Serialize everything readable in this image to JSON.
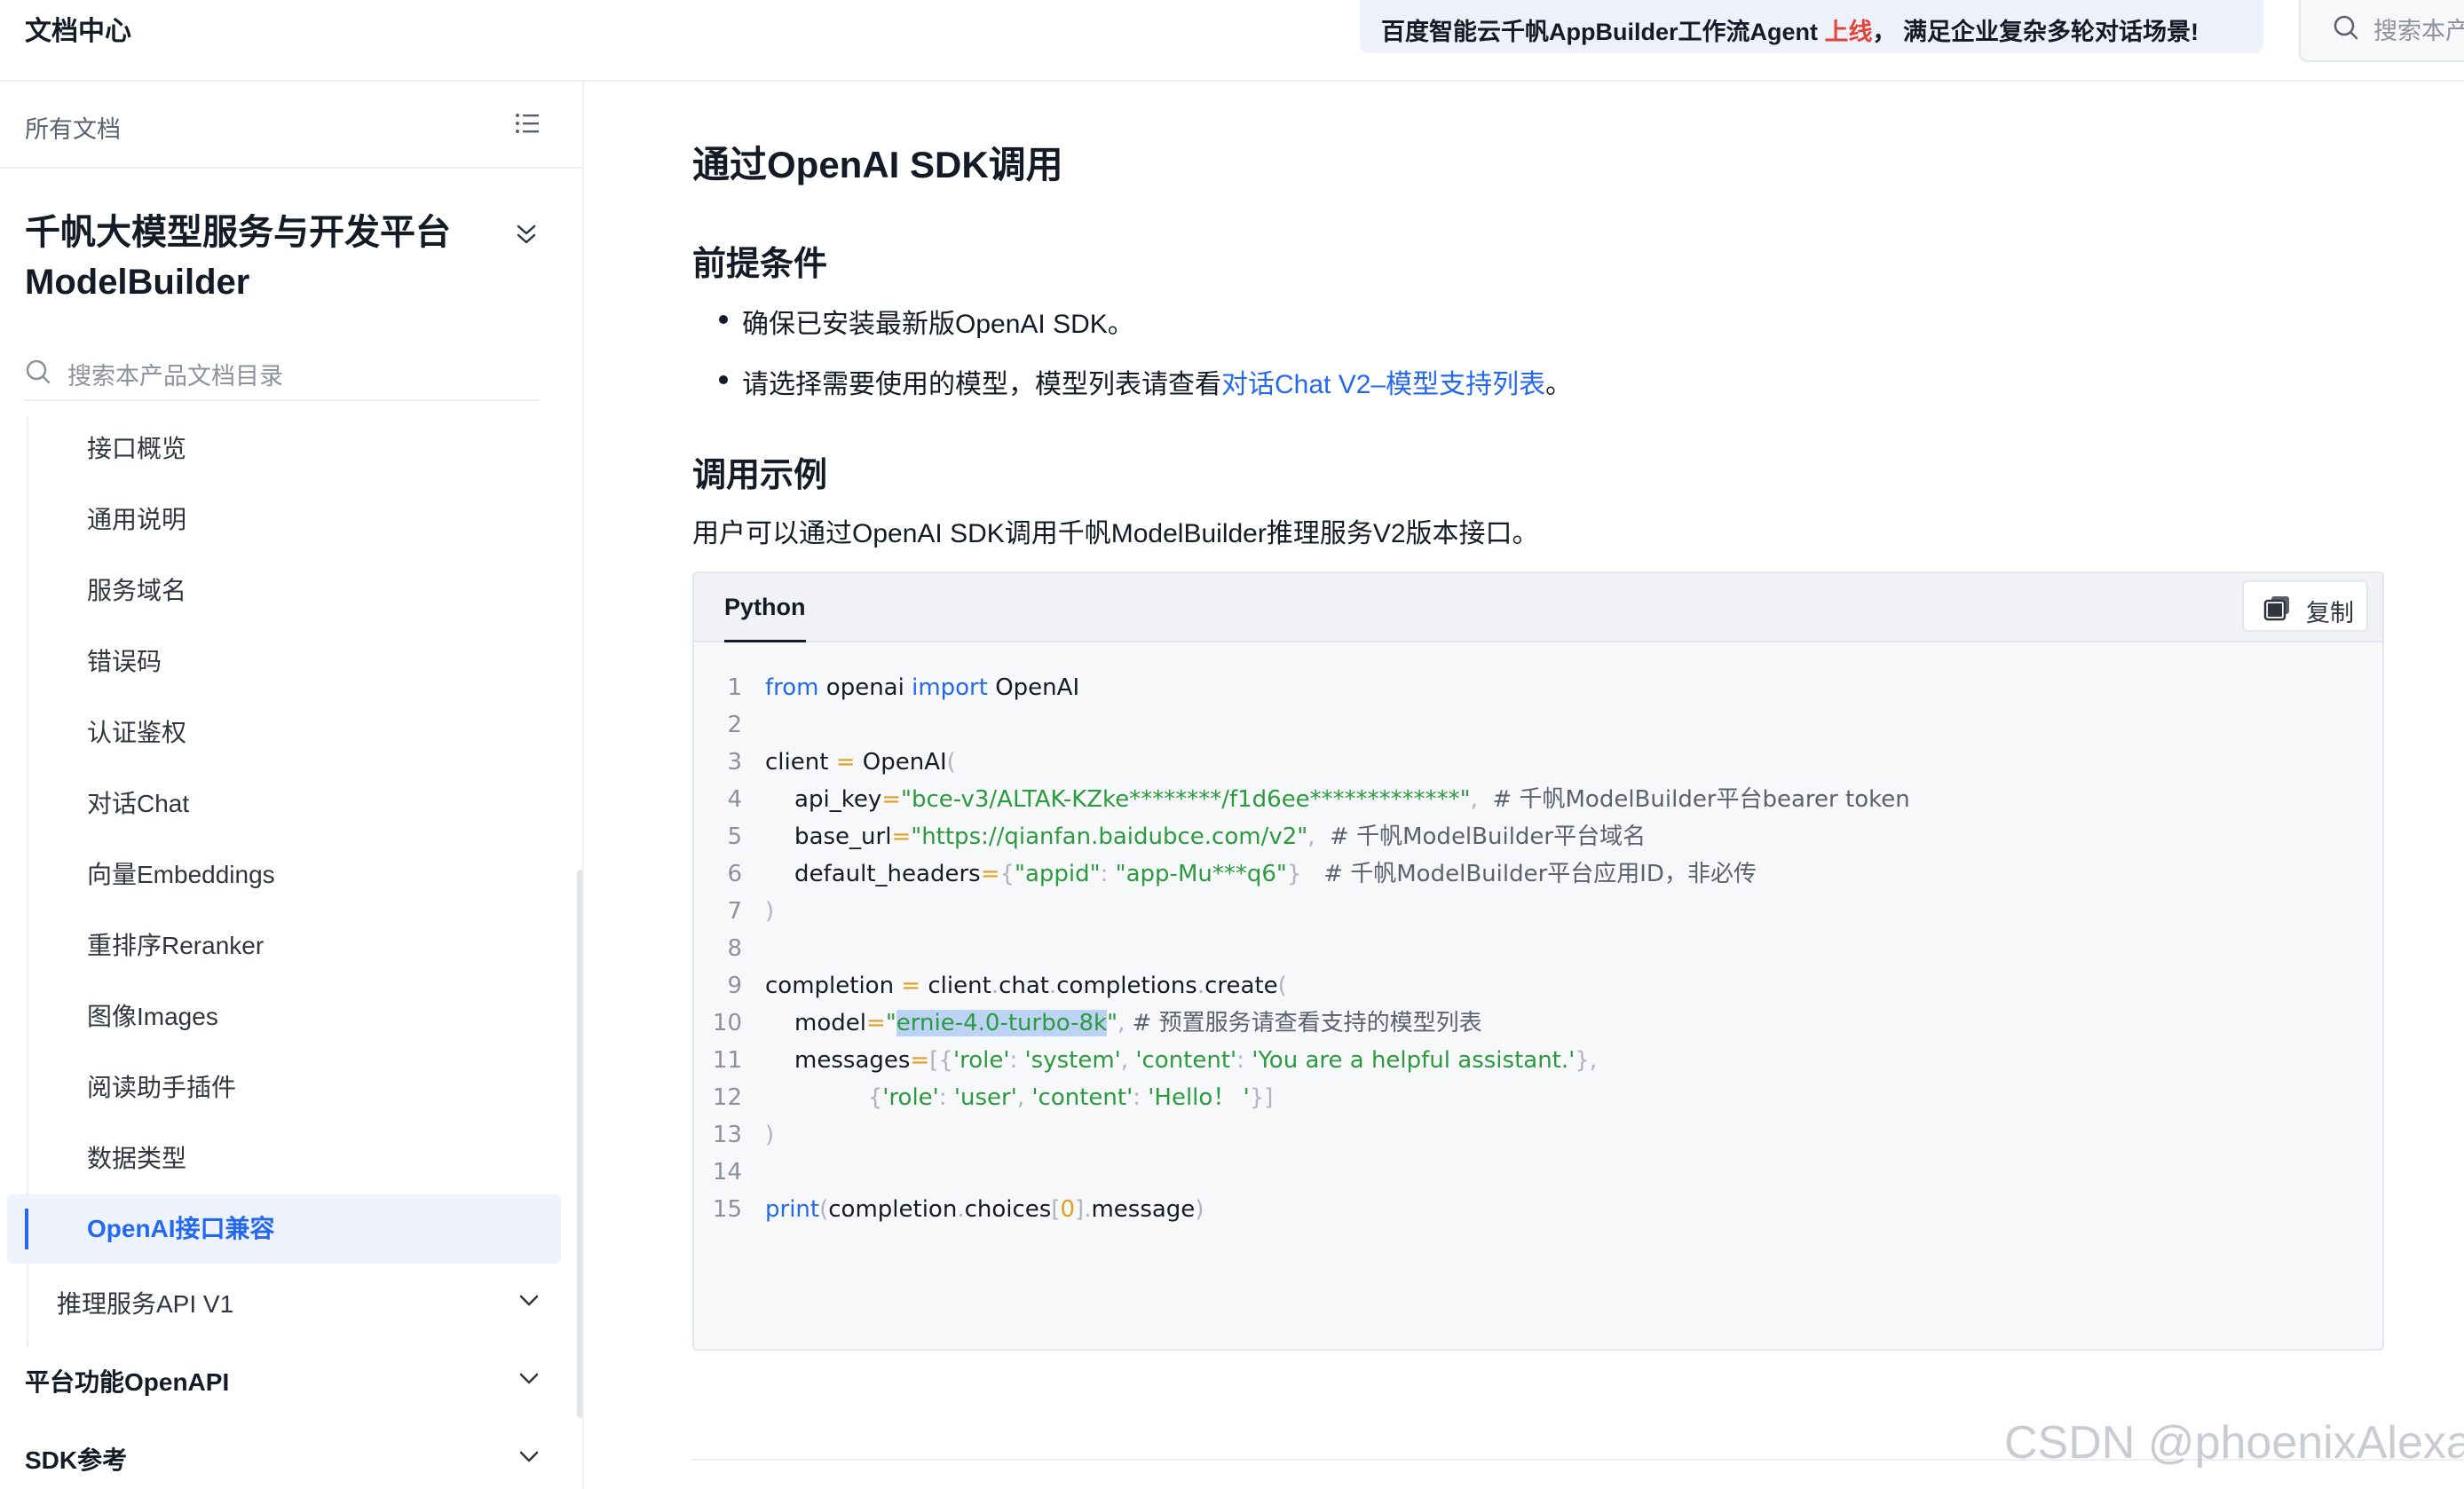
{
  "header": {
    "site_title": "文档中心",
    "banner_prefix": "百度智能云千帆AppBuilder工作流Agent ",
    "banner_highlight": "上线",
    "banner_suffix": "， 满足企业复杂多轮对话场景!",
    "search_placeholder": "搜索本产"
  },
  "sidebar": {
    "all_docs_label": "所有文档",
    "product_title": "千帆大模型服务与开发平台ModelBuilder",
    "search_placeholder": "搜索本产品文档目录",
    "items": [
      {
        "label": "接口概览"
      },
      {
        "label": "通用说明"
      },
      {
        "label": "服务域名"
      },
      {
        "label": "错误码"
      },
      {
        "label": "认证鉴权"
      },
      {
        "label": "对话Chat"
      },
      {
        "label": "向量Embeddings"
      },
      {
        "label": "重排序Reranker"
      },
      {
        "label": "图像Images"
      },
      {
        "label": "阅读助手插件"
      },
      {
        "label": "数据类型"
      }
    ],
    "active_item": "OpenAI接口兼容",
    "group_item": "推理服务API V1",
    "top_sections": [
      "平台功能OpenAPI",
      "SDK参考"
    ]
  },
  "main": {
    "title": "通过OpenAI SDK调用",
    "section_prereq": "前提条件",
    "bullet_1": "确保已安装最新版OpenAI SDK。",
    "bullet_2_prefix": "请选择需要使用的模型，模型列表请查看",
    "bullet_2_link": "对话Chat V2–模型支持列表",
    "bullet_2_suffix": "。",
    "section_example": "调用示例",
    "example_desc": "用户可以通过OpenAI SDK调用千帆ModelBuilder推理服务V2版本接口。",
    "code_language_tab": "Python",
    "copy_label": "复制",
    "code_line_numbers": [
      "1",
      "2",
      "3",
      "4",
      "5",
      "6",
      "7",
      "8",
      "9",
      "10",
      "11",
      "12",
      "13",
      "14",
      "15"
    ]
  },
  "watermark": "CSDN @phoenixAlexa",
  "colors": {
    "accent": "#2468f2",
    "banner_highlight": "#e0443a",
    "code_string": "#2c9a3e",
    "code_operator": "#e09d1e",
    "selection": "#bcd3f5"
  }
}
